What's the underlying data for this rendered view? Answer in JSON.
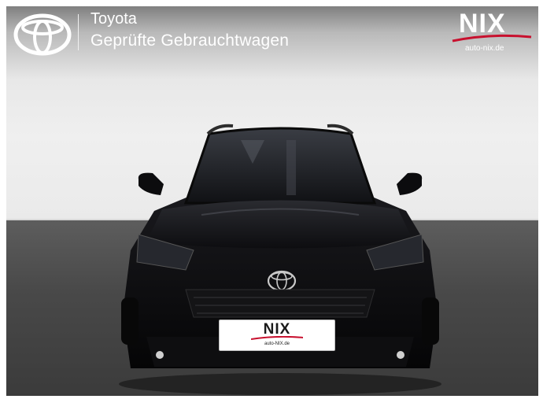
{
  "header": {
    "brand": "Toyota",
    "tagline": "Geprüfte Gebrauchtwagen",
    "dealer_logo_text": "NIX",
    "dealer_url": "auto-nix.de"
  },
  "license_plate": {
    "text": "NIX",
    "url": "auto-NIX.de"
  },
  "colors": {
    "dealer_accent": "#c8102e",
    "car_paint": "#0b0b0d",
    "floor": "#474747",
    "wall": "#ececec"
  },
  "icons": [
    "toyota-emblem-icon",
    "nix-dealer-logo"
  ]
}
